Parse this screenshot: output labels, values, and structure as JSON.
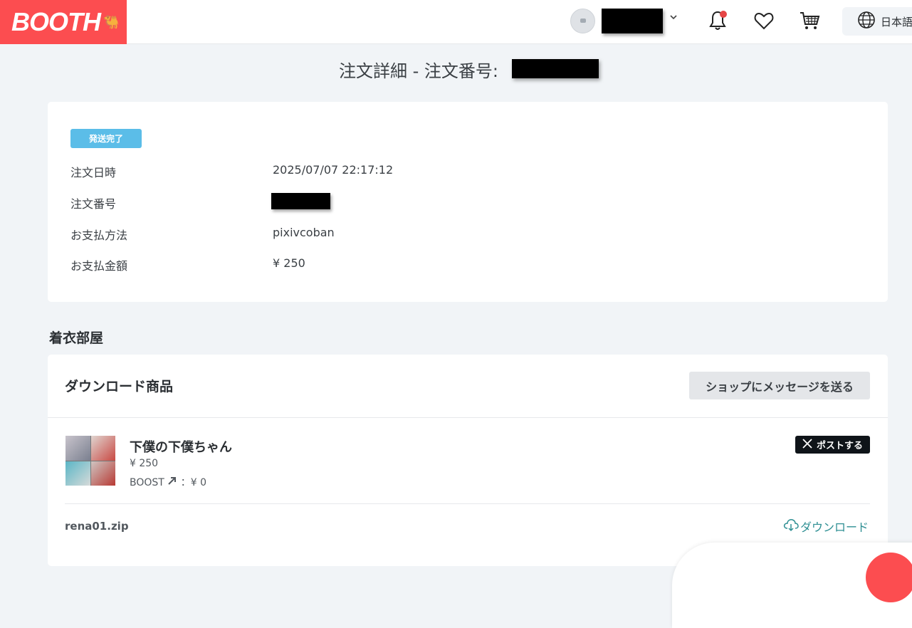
{
  "header": {
    "logo": "BOOTH",
    "logo_mark": "🐫",
    "language": "日本語",
    "icons": [
      "chevron-down-icon",
      "bell-icon",
      "heart-icon",
      "cart-icon",
      "globe-icon"
    ]
  },
  "page": {
    "title": "注文詳細 - 注文番号:"
  },
  "order": {
    "status_badge": "発送完了",
    "rows": [
      {
        "label": "注文日時",
        "value": "2025/07/07 22:17:12"
      },
      {
        "label": "注文番号",
        "value": ""
      },
      {
        "label": "お支払方法",
        "value": "pixivcoban"
      },
      {
        "label": "お支払金額",
        "value": "¥ 250"
      }
    ]
  },
  "shop": {
    "name": "着衣部屋",
    "section_title": "ダウンロード商品",
    "message_button": "ショップにメッセージを送る",
    "item": {
      "name": "下僕の下僕ちゃん",
      "price": "¥ 250",
      "boost_label": "BOOST",
      "boost_value": "：¥ 0",
      "post_button": "ポストする"
    },
    "file": {
      "name": "rena01.zip",
      "download_label": "ダウンロード"
    }
  },
  "colors": {
    "brand": "#fc4d50",
    "badge": "#5bbde8",
    "link": "#2e8f93",
    "background": "#f1f4f7"
  }
}
